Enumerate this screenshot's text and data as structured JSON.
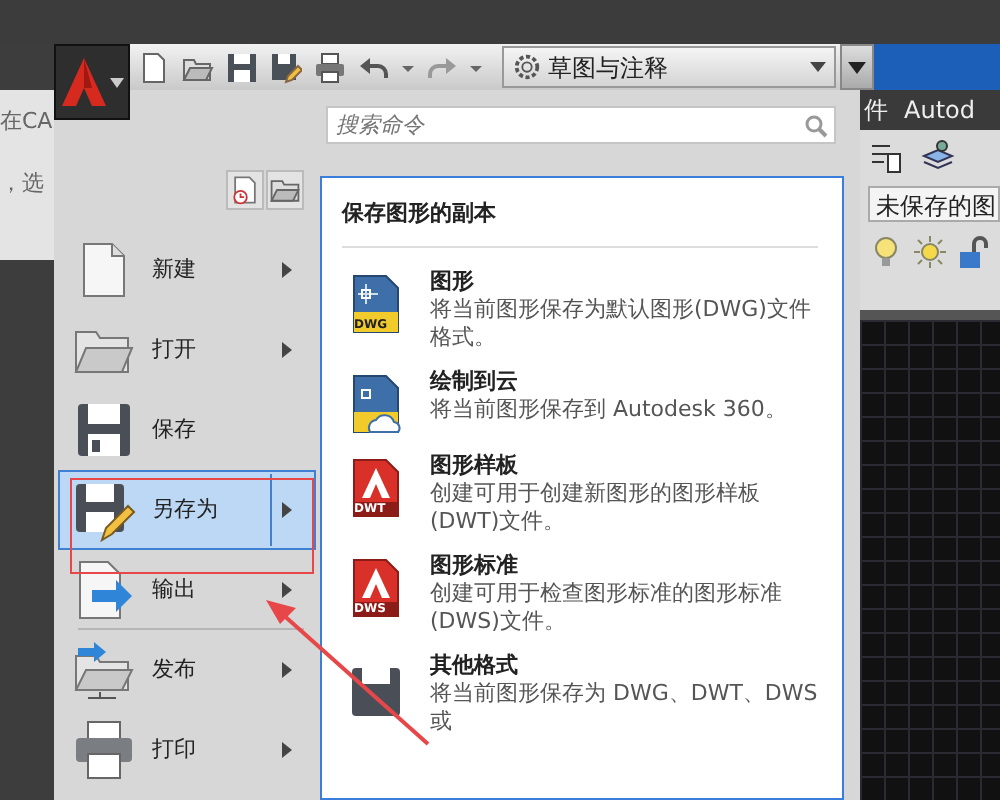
{
  "background_text": [
    "在CA",
    "，选"
  ],
  "quick_access": {
    "workspace": "草图与注释"
  },
  "ribbon": {
    "tabs": [
      "件",
      "Autod"
    ],
    "file_field": "未保存的图"
  },
  "app_menu": {
    "search": {
      "placeholder": "搜索命令"
    },
    "items": [
      {
        "label": "新建",
        "kind": "new",
        "submenu": true,
        "selected": false,
        "separator_before": false
      },
      {
        "label": "打开",
        "kind": "open",
        "submenu": true,
        "selected": false,
        "separator_before": false
      },
      {
        "label": "保存",
        "kind": "save",
        "submenu": false,
        "selected": false,
        "separator_before": false
      },
      {
        "label": "另存为",
        "kind": "saveas",
        "submenu": true,
        "selected": true,
        "separator_before": false
      },
      {
        "label": "输出",
        "kind": "export",
        "submenu": true,
        "selected": false,
        "separator_before": false
      },
      {
        "label": "发布",
        "kind": "publish",
        "submenu": true,
        "selected": false,
        "separator_before": true
      },
      {
        "label": "打印",
        "kind": "print",
        "submenu": true,
        "selected": false,
        "separator_before": false
      }
    ],
    "submenu": {
      "title": "保存图形的副本",
      "items": [
        {
          "kind": "dwg",
          "badge": "DWG",
          "title": "图形",
          "description": "将当前图形保存为默认图形(DWG)文件格式。"
        },
        {
          "kind": "cloud",
          "title": "绘制到云",
          "description": "将当前图形保存到 Autodesk 360。"
        },
        {
          "kind": "dwt",
          "badge": "DWT",
          "title": "图形样板",
          "description": "创建可用于创建新图形的图形样板(DWT)文件。"
        },
        {
          "kind": "dws",
          "badge": "DWS",
          "title": "图形标准",
          "description": "创建可用于检查图形标准的图形标准(DWS)文件。"
        },
        {
          "kind": "other",
          "title": "其他格式",
          "description": "将当前图形保存为 DWG、DWT、DWS 或"
        }
      ]
    }
  }
}
